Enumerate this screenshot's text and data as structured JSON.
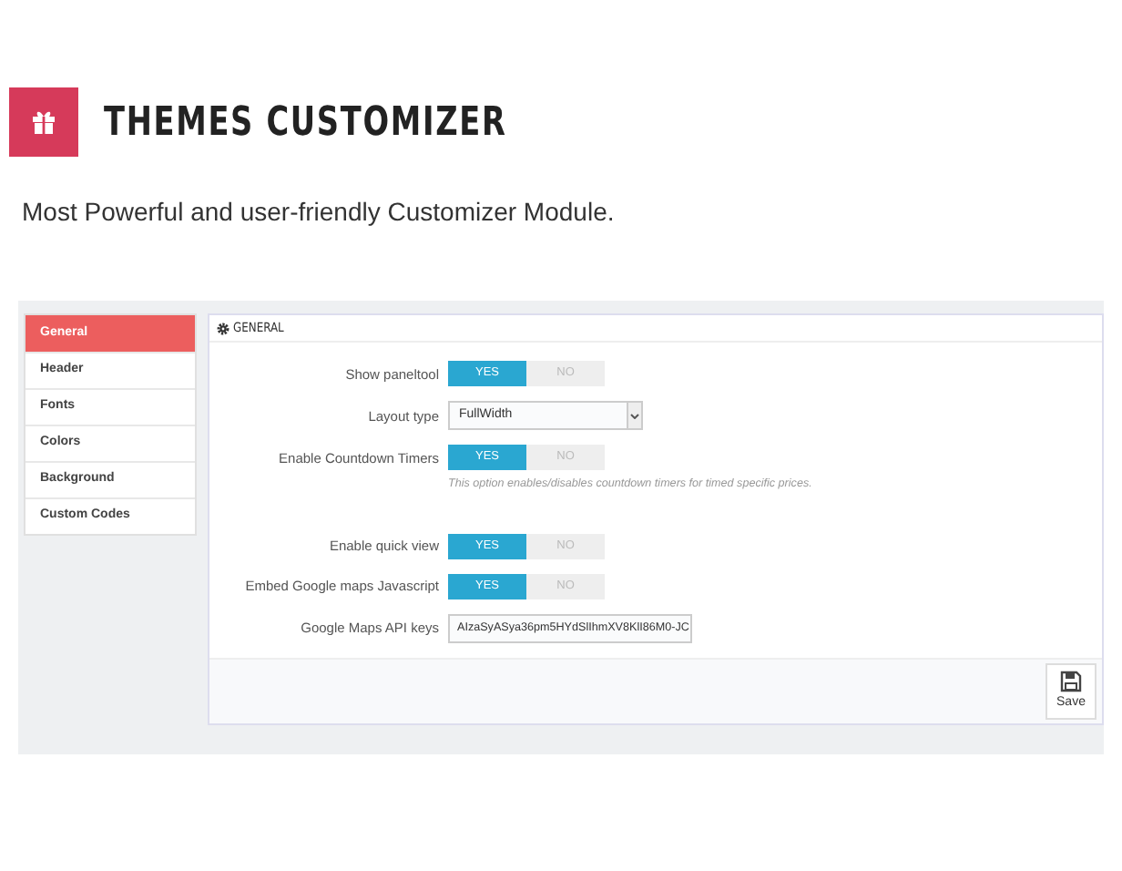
{
  "header": {
    "title": "THEMES CUSTOMIZER",
    "subtitle": "Most Powerful and user-friendly Customizer Module."
  },
  "sidebar": {
    "items": [
      {
        "label": "General",
        "selected": true
      },
      {
        "label": "Header",
        "selected": false
      },
      {
        "label": "Fonts",
        "selected": false
      },
      {
        "label": "Colors",
        "selected": false
      },
      {
        "label": "Background",
        "selected": false
      },
      {
        "label": "Custom Codes",
        "selected": false
      }
    ]
  },
  "panel": {
    "title": "GENERAL",
    "settings": [
      {
        "kind": "toggle",
        "label": "Show paneltool",
        "options": [
          {
            "label": "YES",
            "selected": true
          },
          {
            "label": "NO",
            "selected": false
          }
        ]
      },
      {
        "kind": "select",
        "label": "Layout type",
        "value": "FullWidth"
      },
      {
        "kind": "toggle",
        "label": "Enable Countdown Timers",
        "options": [
          {
            "label": "YES",
            "selected": true
          },
          {
            "label": "NO",
            "selected": false
          }
        ],
        "help": "This option enables/disables countdown timers for timed specific prices."
      },
      {
        "kind": "toggle",
        "label": "Enable quick view",
        "options": [
          {
            "label": "YES",
            "selected": true
          },
          {
            "label": "NO",
            "selected": false
          }
        ]
      },
      {
        "kind": "toggle",
        "label": "Embed Google maps Javascript",
        "options": [
          {
            "label": "YES",
            "selected": true
          },
          {
            "label": "NO",
            "selected": false
          }
        ]
      },
      {
        "kind": "text",
        "label": "Google Maps API keys",
        "value": "AIzaSyASya36pm5HYdSlIhmXV8KlI86M0-JC"
      }
    ],
    "save_button": "Save"
  }
}
